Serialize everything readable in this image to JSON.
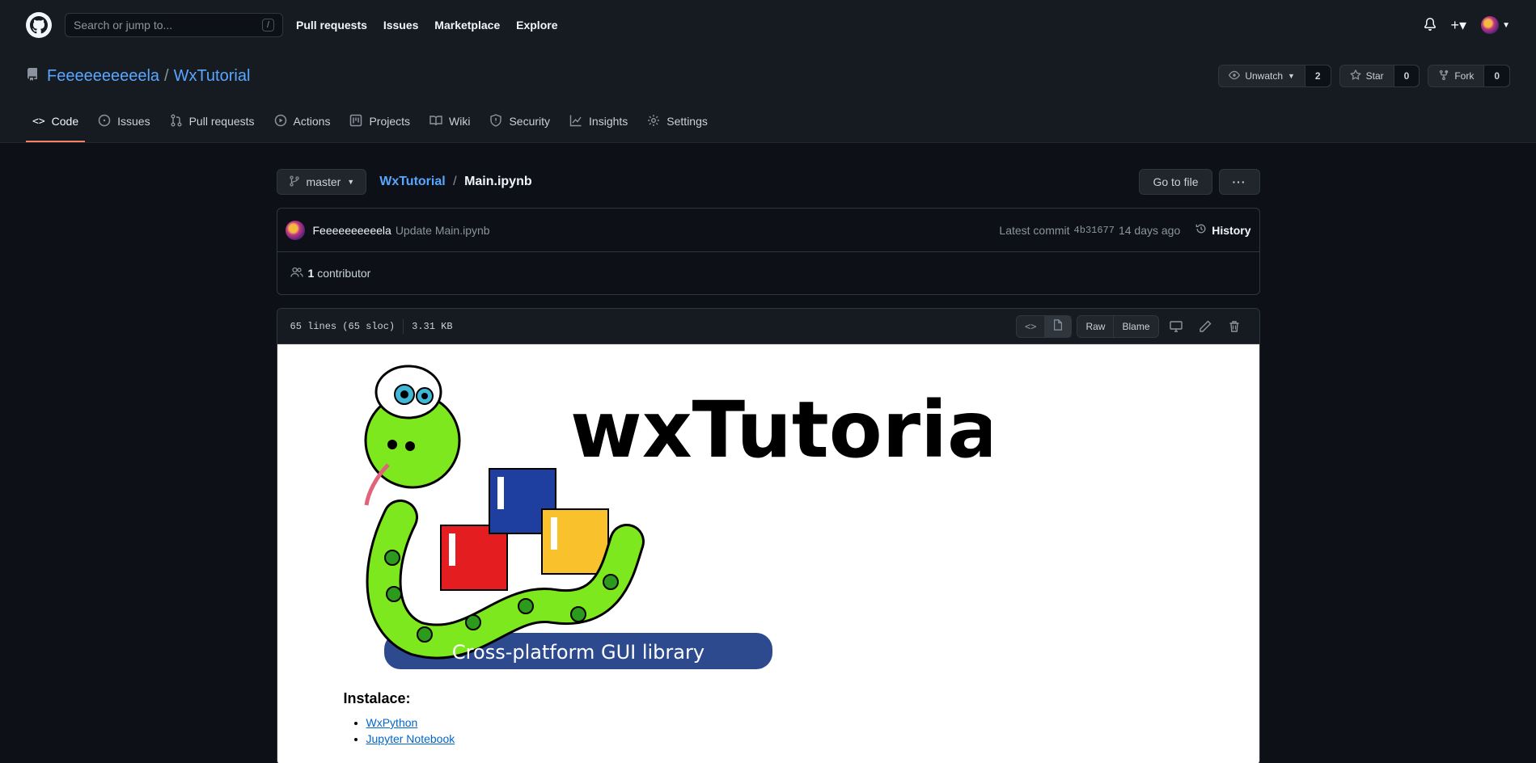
{
  "header": {
    "search_placeholder": "Search or jump to...",
    "slash_key": "/",
    "nav": [
      "Pull requests",
      "Issues",
      "Marketplace",
      "Explore"
    ]
  },
  "repo": {
    "owner": "Feeeeeeeeeela",
    "name": "WxTutorial",
    "watch_label": "Unwatch",
    "watch_count": "2",
    "star_label": "Star",
    "star_count": "0",
    "fork_label": "Fork",
    "fork_count": "0"
  },
  "tabs": [
    {
      "label": "Code",
      "icon": "code-icon"
    },
    {
      "label": "Issues",
      "icon": "issue-icon"
    },
    {
      "label": "Pull requests",
      "icon": "pull-request-icon"
    },
    {
      "label": "Actions",
      "icon": "play-icon"
    },
    {
      "label": "Projects",
      "icon": "project-icon"
    },
    {
      "label": "Wiki",
      "icon": "book-icon"
    },
    {
      "label": "Security",
      "icon": "shield-icon"
    },
    {
      "label": "Insights",
      "icon": "graph-icon"
    },
    {
      "label": "Settings",
      "icon": "gear-icon"
    }
  ],
  "path": {
    "branch": "master",
    "repo": "WxTutorial",
    "file": "Main.ipynb",
    "goto_label": "Go to file",
    "more_label": "···"
  },
  "commit": {
    "author": "Feeeeeeeeeela",
    "message": "Update Main.ipynb",
    "latest_label": "Latest commit",
    "sha": "4b31677",
    "age": "14 days ago",
    "history_label": "History",
    "contrib_count": "1",
    "contrib_label": "contributor"
  },
  "file": {
    "lines": "65 lines (65 sloc)",
    "size": "3.31 KB",
    "raw_label": "Raw",
    "blame_label": "Blame"
  },
  "notebook": {
    "banner_title": "wxTutorial",
    "banner_caption": "Cross-platform GUI library",
    "heading": "Instalace:",
    "links": [
      "WxPython",
      "Jupyter Notebook"
    ]
  }
}
